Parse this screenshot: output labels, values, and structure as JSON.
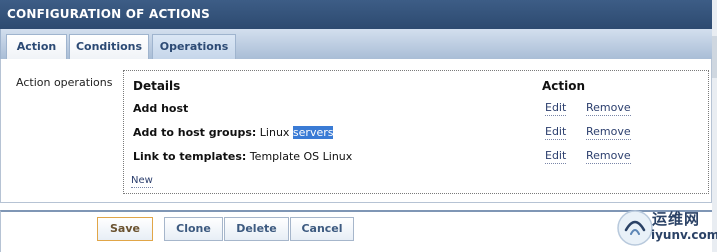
{
  "header": {
    "title": "CONFIGURATION OF ACTIONS"
  },
  "tabs": [
    {
      "label": "Action",
      "active": false
    },
    {
      "label": "Conditions",
      "active": false
    },
    {
      "label": "Operations",
      "active": true
    }
  ],
  "operations": {
    "row_label": "Action operations",
    "columns": {
      "details": "Details",
      "action": "Action"
    },
    "rows": [
      {
        "label": "Add host",
        "value": "",
        "value_selected": "",
        "edit": "Edit",
        "remove": "Remove"
      },
      {
        "label": "Add to host groups:",
        "value": "Linux ",
        "value_selected": "servers",
        "edit": "Edit",
        "remove": "Remove"
      },
      {
        "label": "Link to templates:",
        "value": "Template OS Linux",
        "value_selected": "",
        "edit": "Edit",
        "remove": "Remove"
      }
    ],
    "new_link": "New"
  },
  "footer": {
    "save": "Save",
    "clone": "Clone",
    "delete": "Delete",
    "cancel": "Cancel"
  },
  "watermark": {
    "cn": "运维网",
    "url": "iyunv.com"
  },
  "colors": {
    "header_bg": "#2d4a70",
    "tabbar_bg": "#a9bdd6",
    "link": "#2c3f6e",
    "selection": "#3a7bd5",
    "save_border": "#e1a648"
  }
}
